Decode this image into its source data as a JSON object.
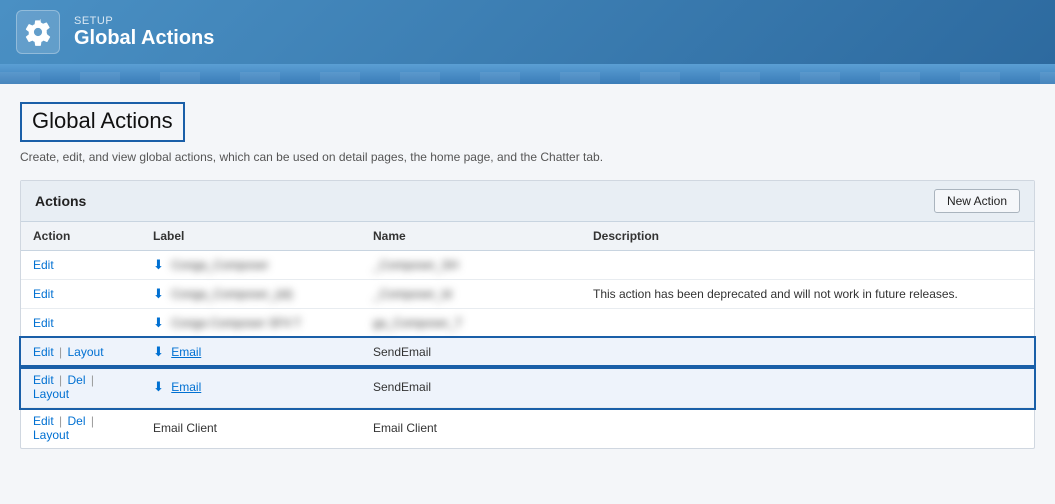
{
  "header": {
    "setup_label": "SETUP",
    "title": "Global Actions"
  },
  "page": {
    "heading": "Global Actions",
    "description": "Create, edit, and view global actions, which can be used on detail pages, the home page, and the Chatter tab."
  },
  "actions_panel": {
    "title": "Actions",
    "new_action_button": "New Action"
  },
  "table": {
    "columns": [
      "Action",
      "Label",
      "Name",
      "Description"
    ],
    "rows": [
      {
        "action": "Edit",
        "label_blurred": true,
        "label_text": "Conga_Composer",
        "label_icon": true,
        "name_blurred": true,
        "name_text": "_Composer_SH",
        "description": "",
        "highlighted": false
      },
      {
        "action": "Edit",
        "label_blurred": true,
        "label_text": "Conga_Composer_(id)",
        "label_icon": true,
        "name_blurred": true,
        "name_text": "_Composer_Id",
        "description": "This action has been deprecated and will not work in future releases.",
        "highlighted": false
      },
      {
        "action": "Edit",
        "label_blurred": true,
        "label_text": "Conga Composer SF4 T",
        "label_icon": true,
        "name_blurred": true,
        "name_text": "ga_Composer_T",
        "description": "",
        "highlighted": false
      },
      {
        "action_parts": [
          "Edit",
          "Layout"
        ],
        "label_text": "Email",
        "label_icon": true,
        "name_text": "SendEmail",
        "description": "",
        "highlighted": true
      },
      {
        "action_parts": [
          "Edit",
          "Del",
          "Layout"
        ],
        "label_text": "Email",
        "label_icon": true,
        "name_text": "SendEmail",
        "description": "",
        "highlighted": true
      },
      {
        "action_parts": [
          "Edit",
          "Del",
          "Layout"
        ],
        "label_text": "Email Client",
        "label_icon": false,
        "name_text": "Email Client",
        "description": "",
        "highlighted": false
      }
    ]
  }
}
